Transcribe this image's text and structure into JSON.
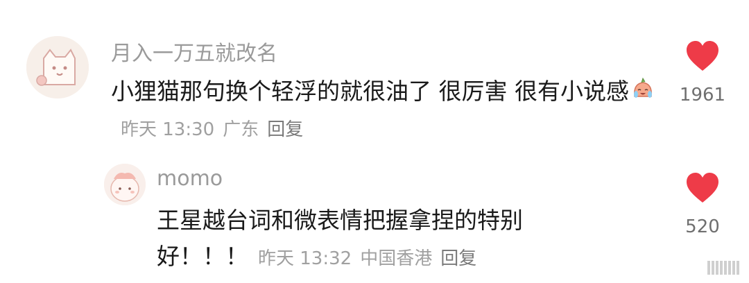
{
  "comments": [
    {
      "username": "月入一万五就改名",
      "text": "小狸猫那句换个轻浮的就很油了 很厉害 很有小说感",
      "emoji": "crying-laughing-emoji",
      "time": "昨天 13:30",
      "location": "广东",
      "reply_label": "回复",
      "likes": "1961"
    },
    {
      "username": "momo",
      "text": "王星越台词和微表情把握拿捏的特别好！！！",
      "time": "昨天 13:32",
      "location": "中国香港",
      "reply_label": "回复",
      "likes": "520"
    }
  ],
  "colors": {
    "heart": "#ee3b48",
    "username": "#9a9a9a",
    "text": "#1a1a1a",
    "meta": "#a0a0a0"
  }
}
